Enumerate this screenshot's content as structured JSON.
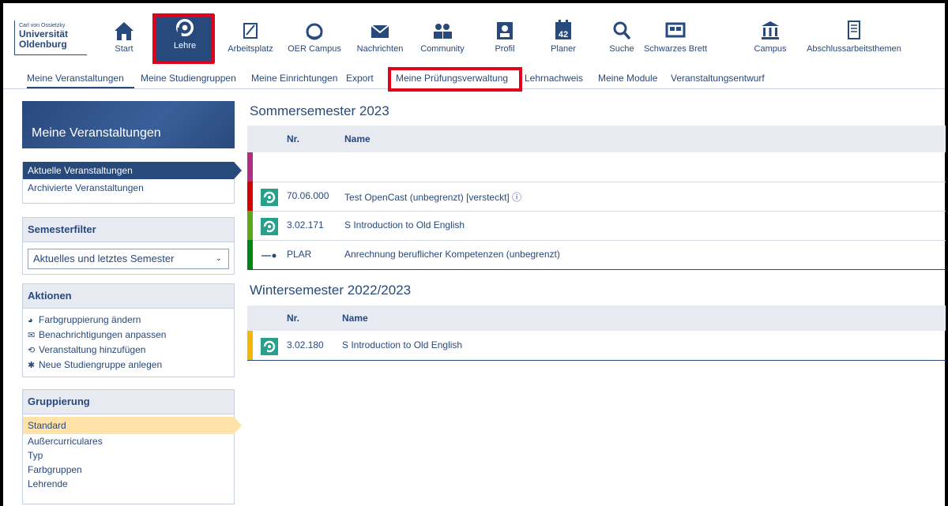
{
  "logo": {
    "line1": "Carl von Ossietzky",
    "line2": "Universität",
    "line3": "Oldenburg"
  },
  "nav": [
    {
      "label": "Start",
      "icon": "home-icon"
    },
    {
      "label": "Lehre",
      "icon": "lehre-icon",
      "active": true
    },
    {
      "label": "Arbeitsplatz",
      "icon": "workplace-icon"
    },
    {
      "label": "OER Campus",
      "icon": "oer-icon"
    },
    {
      "label": "Nachrichten",
      "icon": "mail-icon"
    },
    {
      "label": "Community",
      "icon": "community-icon"
    },
    {
      "label": "Profil",
      "icon": "profile-icon"
    },
    {
      "label": "Planer",
      "icon": "calendar-icon",
      "calendar_day": "42"
    },
    {
      "label": "Suche",
      "icon": "search-icon"
    },
    {
      "label": "Schwarzes Brett",
      "icon": "board-icon"
    },
    {
      "label": "Campus",
      "icon": "campus-icon"
    },
    {
      "label": "Abschlussarbeitsthemen",
      "icon": "thesis-icon"
    }
  ],
  "subnav": [
    "Meine Veranstaltungen",
    "Meine Studiengruppen",
    "Meine Einrichtungen",
    "Export",
    "Meine Prüfungsverwaltung",
    "Lehrnachweis",
    "Meine Module",
    "Veranstaltungsentwurf"
  ],
  "sidebar": {
    "title": "Meine Veranstaltungen",
    "views": [
      "Aktuelle Veranstaltungen",
      "Archivierte Veranstaltungen"
    ],
    "semesterfilter": {
      "title": "Semesterfilter",
      "value": "Aktuelles und letztes Semester"
    },
    "aktionen": {
      "title": "Aktionen",
      "items": [
        "Farbgruppierung ändern",
        "Benachrichtigungen anpassen",
        "Veranstaltung hinzufügen",
        "Neue Studiengruppe anlegen"
      ]
    },
    "gruppierung": {
      "title": "Gruppierung",
      "items": [
        "Standard",
        "Außercurriculares",
        "Typ",
        "Farbgruppen",
        "Lehrende"
      ]
    }
  },
  "main": {
    "col_nr": "Nr.",
    "col_name": "Name",
    "semesters": [
      {
        "title": "Sommersemester 2023",
        "rows": [
          {
            "nr": "",
            "name": "",
            "color": "#b02e84",
            "icon": "none"
          },
          {
            "nr": "70.06.000",
            "name": "Test OpenCast (unbegrenzt) [versteckt] ⓘ",
            "color": "#d60000",
            "icon": "course-icon"
          },
          {
            "nr": "3.02.171",
            "name": "S Introduction to Old English",
            "color": "#5ba81d",
            "icon": "course-icon"
          },
          {
            "nr": "PLAR",
            "name": "Anrechnung beruflicher Kompetenzen (unbegrenzt)",
            "color": "#008512",
            "icon": "plar-icon"
          }
        ]
      },
      {
        "title": "Wintersemester 2022/2023",
        "rows": [
          {
            "nr": "3.02.180",
            "name": "S Introduction to Old English",
            "color": "#f5b800",
            "icon": "course-icon"
          }
        ]
      }
    ]
  }
}
